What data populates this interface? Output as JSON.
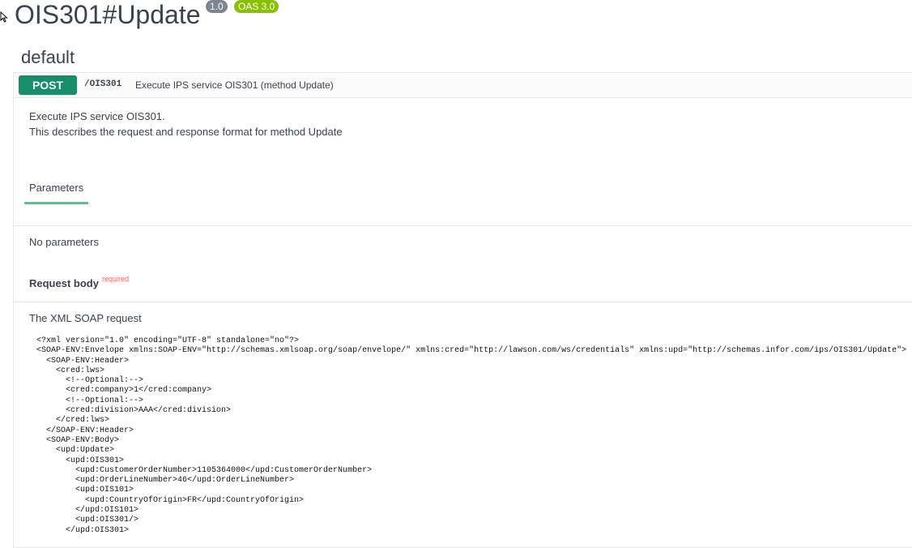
{
  "header": {
    "title": "OIS301#Update",
    "version_badge": "1.0",
    "oas_badge": "OAS 3.0"
  },
  "section": {
    "title": "default"
  },
  "operation": {
    "method": "POST",
    "path": "/OIS301",
    "summary": "Execute IPS service OIS301 (method Update)",
    "description_line1": "Execute IPS service OIS301.",
    "description_line2": "This describes the request and response format for method Update"
  },
  "parameters": {
    "tab_label": "Parameters",
    "empty_text": "No parameters"
  },
  "request_body": {
    "title": "Request body",
    "required_label": "required",
    "xml_title": "The XML SOAP request"
  },
  "xml_lines": [
    "<?xml version=\"1.0\" encoding=\"UTF-8\" standalone=\"no\"?>",
    "<SOAP-ENV:Envelope xmlns:SOAP-ENV=\"http://schemas.xmlsoap.org/soap/envelope/\" xmlns:cred=\"http://lawson.com/ws/credentials\" xmlns:upd=\"http://schemas.infor.com/ips/OIS301/Update\">",
    "  <SOAP-ENV:Header>",
    "    <cred:lws>",
    "      <!--Optional:-->",
    "      <cred:company>1</cred:company>",
    "      <!--Optional:-->",
    "      <cred:division>AAA</cred:division>",
    "    </cred:lws>",
    "  </SOAP-ENV:Header>",
    "  <SOAP-ENV:Body>",
    "    <upd:Update>",
    "      <upd:OIS301>",
    "        <upd:CustomerOrderNumber>1105364000</upd:CustomerOrderNumber>",
    "        <upd:OrderLineNumber>46</upd:OrderLineNumber>",
    "        <upd:OIS101>",
    "          <upd:CountryOfOrigin>FR</upd:CountryOfOrigin>",
    "        </upd:OIS101>",
    "        <upd:OIS301/>",
    "      </upd:OIS301>"
  ]
}
